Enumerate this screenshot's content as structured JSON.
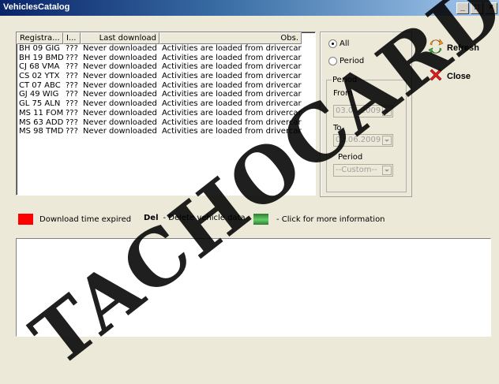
{
  "window": {
    "title": "VehiclesCatalog",
    "btn_min": "_",
    "btn_max": "□",
    "btn_close": "×"
  },
  "table": {
    "headers": [
      "Registra...",
      "I...",
      "Last download",
      "Obs."
    ],
    "rows": [
      {
        "reg": "BH 09 GIG",
        "i": "???",
        "last": "Never downloaded",
        "obs": "Activities are loaded from drivercards"
      },
      {
        "reg": "BH 19 BMD",
        "i": "???",
        "last": "Never downloaded",
        "obs": "Activities are loaded from drivercards"
      },
      {
        "reg": "CJ 68 VMA",
        "i": "???",
        "last": "Never downloaded",
        "obs": "Activities are loaded from drivercards"
      },
      {
        "reg": "CS 02 YTX",
        "i": "???",
        "last": "Never downloaded",
        "obs": "Activities are loaded from drivercards"
      },
      {
        "reg": "CT 07 ABC",
        "i": "???",
        "last": "Never downloaded",
        "obs": "Activities are loaded from drivercards"
      },
      {
        "reg": "GJ 49 WIG",
        "i": "???",
        "last": "Never downloaded",
        "obs": "Activities are loaded from drivercards"
      },
      {
        "reg": "GL 75 ALN",
        "i": "???",
        "last": "Never downloaded",
        "obs": "Activities are loaded from drivercards"
      },
      {
        "reg": "MS 11 FOM",
        "i": "???",
        "last": "Never downloaded",
        "obs": "Activities are loaded from drivercards"
      },
      {
        "reg": "MS 63 ADD",
        "i": "???",
        "last": "Never downloaded",
        "obs": "Activities are loaded from drivercards"
      },
      {
        "reg": "MS 98 TMD",
        "i": "???",
        "last": "Never downloaded",
        "obs": "Activities are loaded from drivercards"
      }
    ]
  },
  "filter": {
    "all_label": "All",
    "period_label": "Period",
    "selected": "all",
    "period_group_label": "Period",
    "from_label": "From",
    "from_value": "03.06.2009",
    "to_label": "To",
    "to_value": "03.06.2009",
    "period_select_label": "Period",
    "period_value": "--Custom--"
  },
  "actions": {
    "refresh": "Refresh",
    "close": "Close"
  },
  "legend": {
    "expired": "Download time expired",
    "del_key": "Del",
    "del_text": "- Delete vehicle data",
    "info_text": "- Click for more information"
  },
  "colors": {
    "expired": "#ff0000",
    "info": "#3cbf4c"
  },
  "watermark": "TACHOCARD"
}
